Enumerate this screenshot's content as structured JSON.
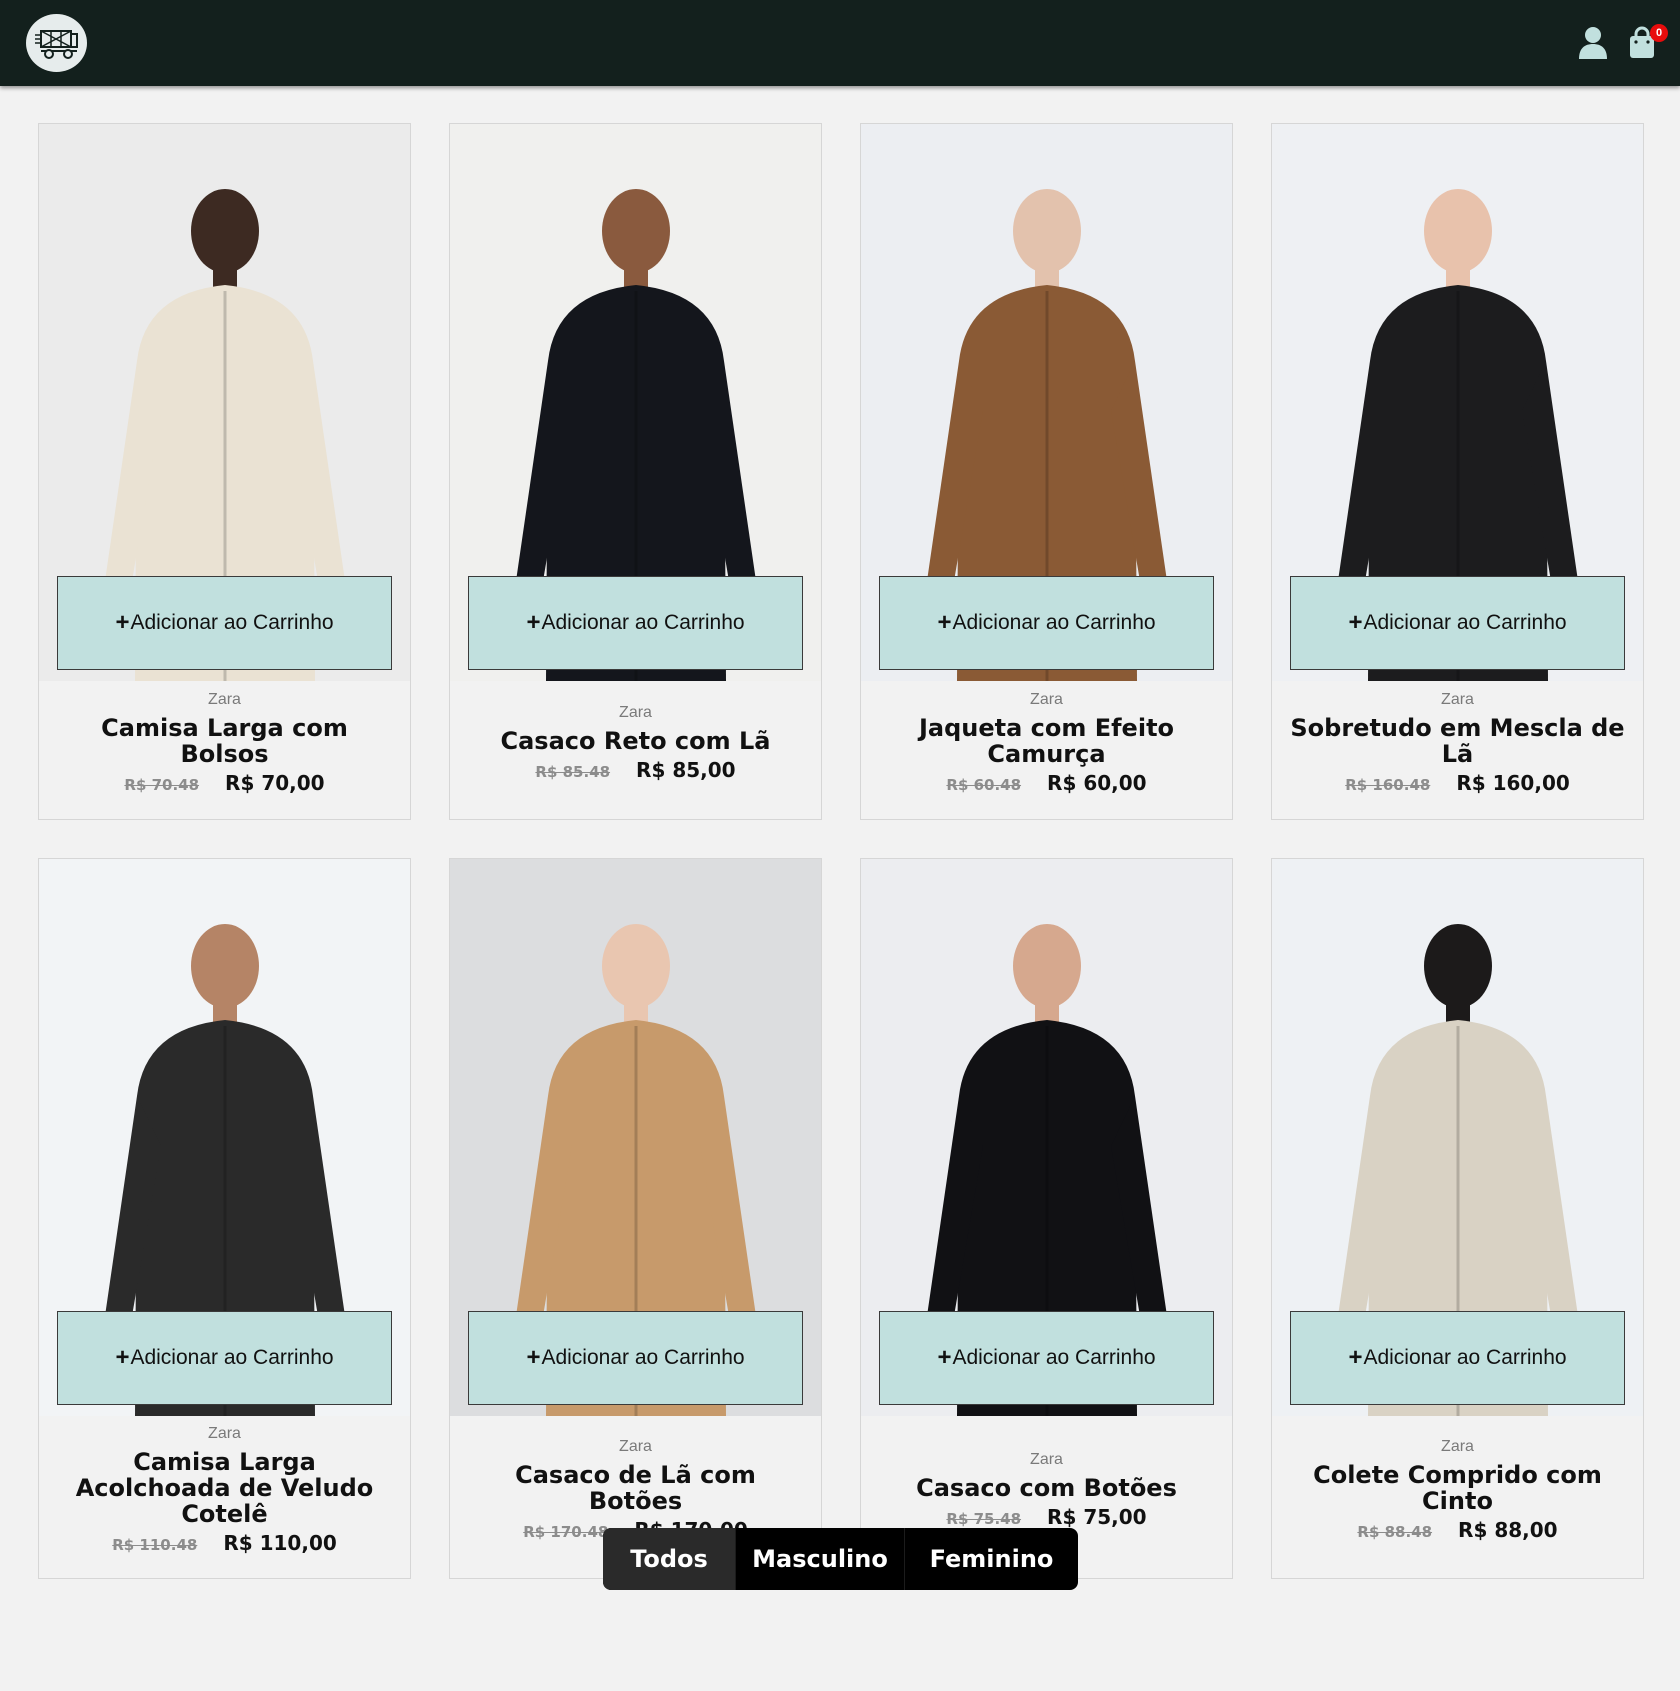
{
  "header": {
    "cart_count": "0"
  },
  "colors": {
    "header_bg": "#13201d",
    "button_bg": "#c1e0de",
    "badge": "#e80c0c"
  },
  "icons": [
    "truck-logo-icon",
    "user-icon",
    "shopping-bag-icon",
    "plus-icon"
  ],
  "add_to_cart_label": "Adicionar ao Carrinho",
  "products": [
    {
      "brand": "Zara",
      "title": "Camisa Larga com Bolsos",
      "old_price": "R$ 70.48",
      "price": "R$ 70,00",
      "bg": "#ebebeb",
      "garment": "#eae2d3",
      "skin": "#3d2a22"
    },
    {
      "brand": "Zara",
      "title": "Casaco Reto com Lã",
      "old_price": "R$ 85.48",
      "price": "R$ 85,00",
      "bg": "#f0f0ee",
      "garment": "#14161c",
      "skin": "#8a5a3e"
    },
    {
      "brand": "Zara",
      "title": "Jaqueta com Efeito Camurça",
      "old_price": "R$ 60.48",
      "price": "R$ 60,00",
      "bg": "#eceef2",
      "garment": "#8a5a35",
      "skin": "#e3c2ad"
    },
    {
      "brand": "Zara",
      "title": "Sobretudo em Mescla de Lã",
      "old_price": "R$ 160.48",
      "price": "R$ 160,00",
      "bg": "#eef0f3",
      "garment": "#1c1c1e",
      "skin": "#e8c2ac"
    },
    {
      "brand": "Zara",
      "title": "Camisa Larga Acolchoada de Veludo Cotelê",
      "old_price": "R$ 110.48",
      "price": "R$ 110,00",
      "bg": "#f2f4f6",
      "garment": "#2a2a2a",
      "skin": "#b58466"
    },
    {
      "brand": "Zara",
      "title": "Casaco de Lã com Botões",
      "old_price": "R$ 170.48",
      "price": "R$ 170,00",
      "bg": "#dcdddf",
      "garment": "#c79a6b",
      "skin": "#e9c6b0"
    },
    {
      "brand": "Zara",
      "title": "Casaco com Botões",
      "old_price": "R$ 75.48",
      "price": "R$ 75,00",
      "bg": "#ecedf0",
      "garment": "#111114",
      "skin": "#d6a88e"
    },
    {
      "brand": "Zara",
      "title": "Colete Comprido com Cinto",
      "old_price": "R$ 88.48",
      "price": "R$ 88,00",
      "bg": "#eef1f4",
      "garment": "#d9d2c4",
      "skin": "#1c1a1a"
    }
  ],
  "filters": [
    {
      "label": "Todos",
      "active": true
    },
    {
      "label": "Masculino",
      "active": false
    },
    {
      "label": "Feminino",
      "active": false
    }
  ]
}
